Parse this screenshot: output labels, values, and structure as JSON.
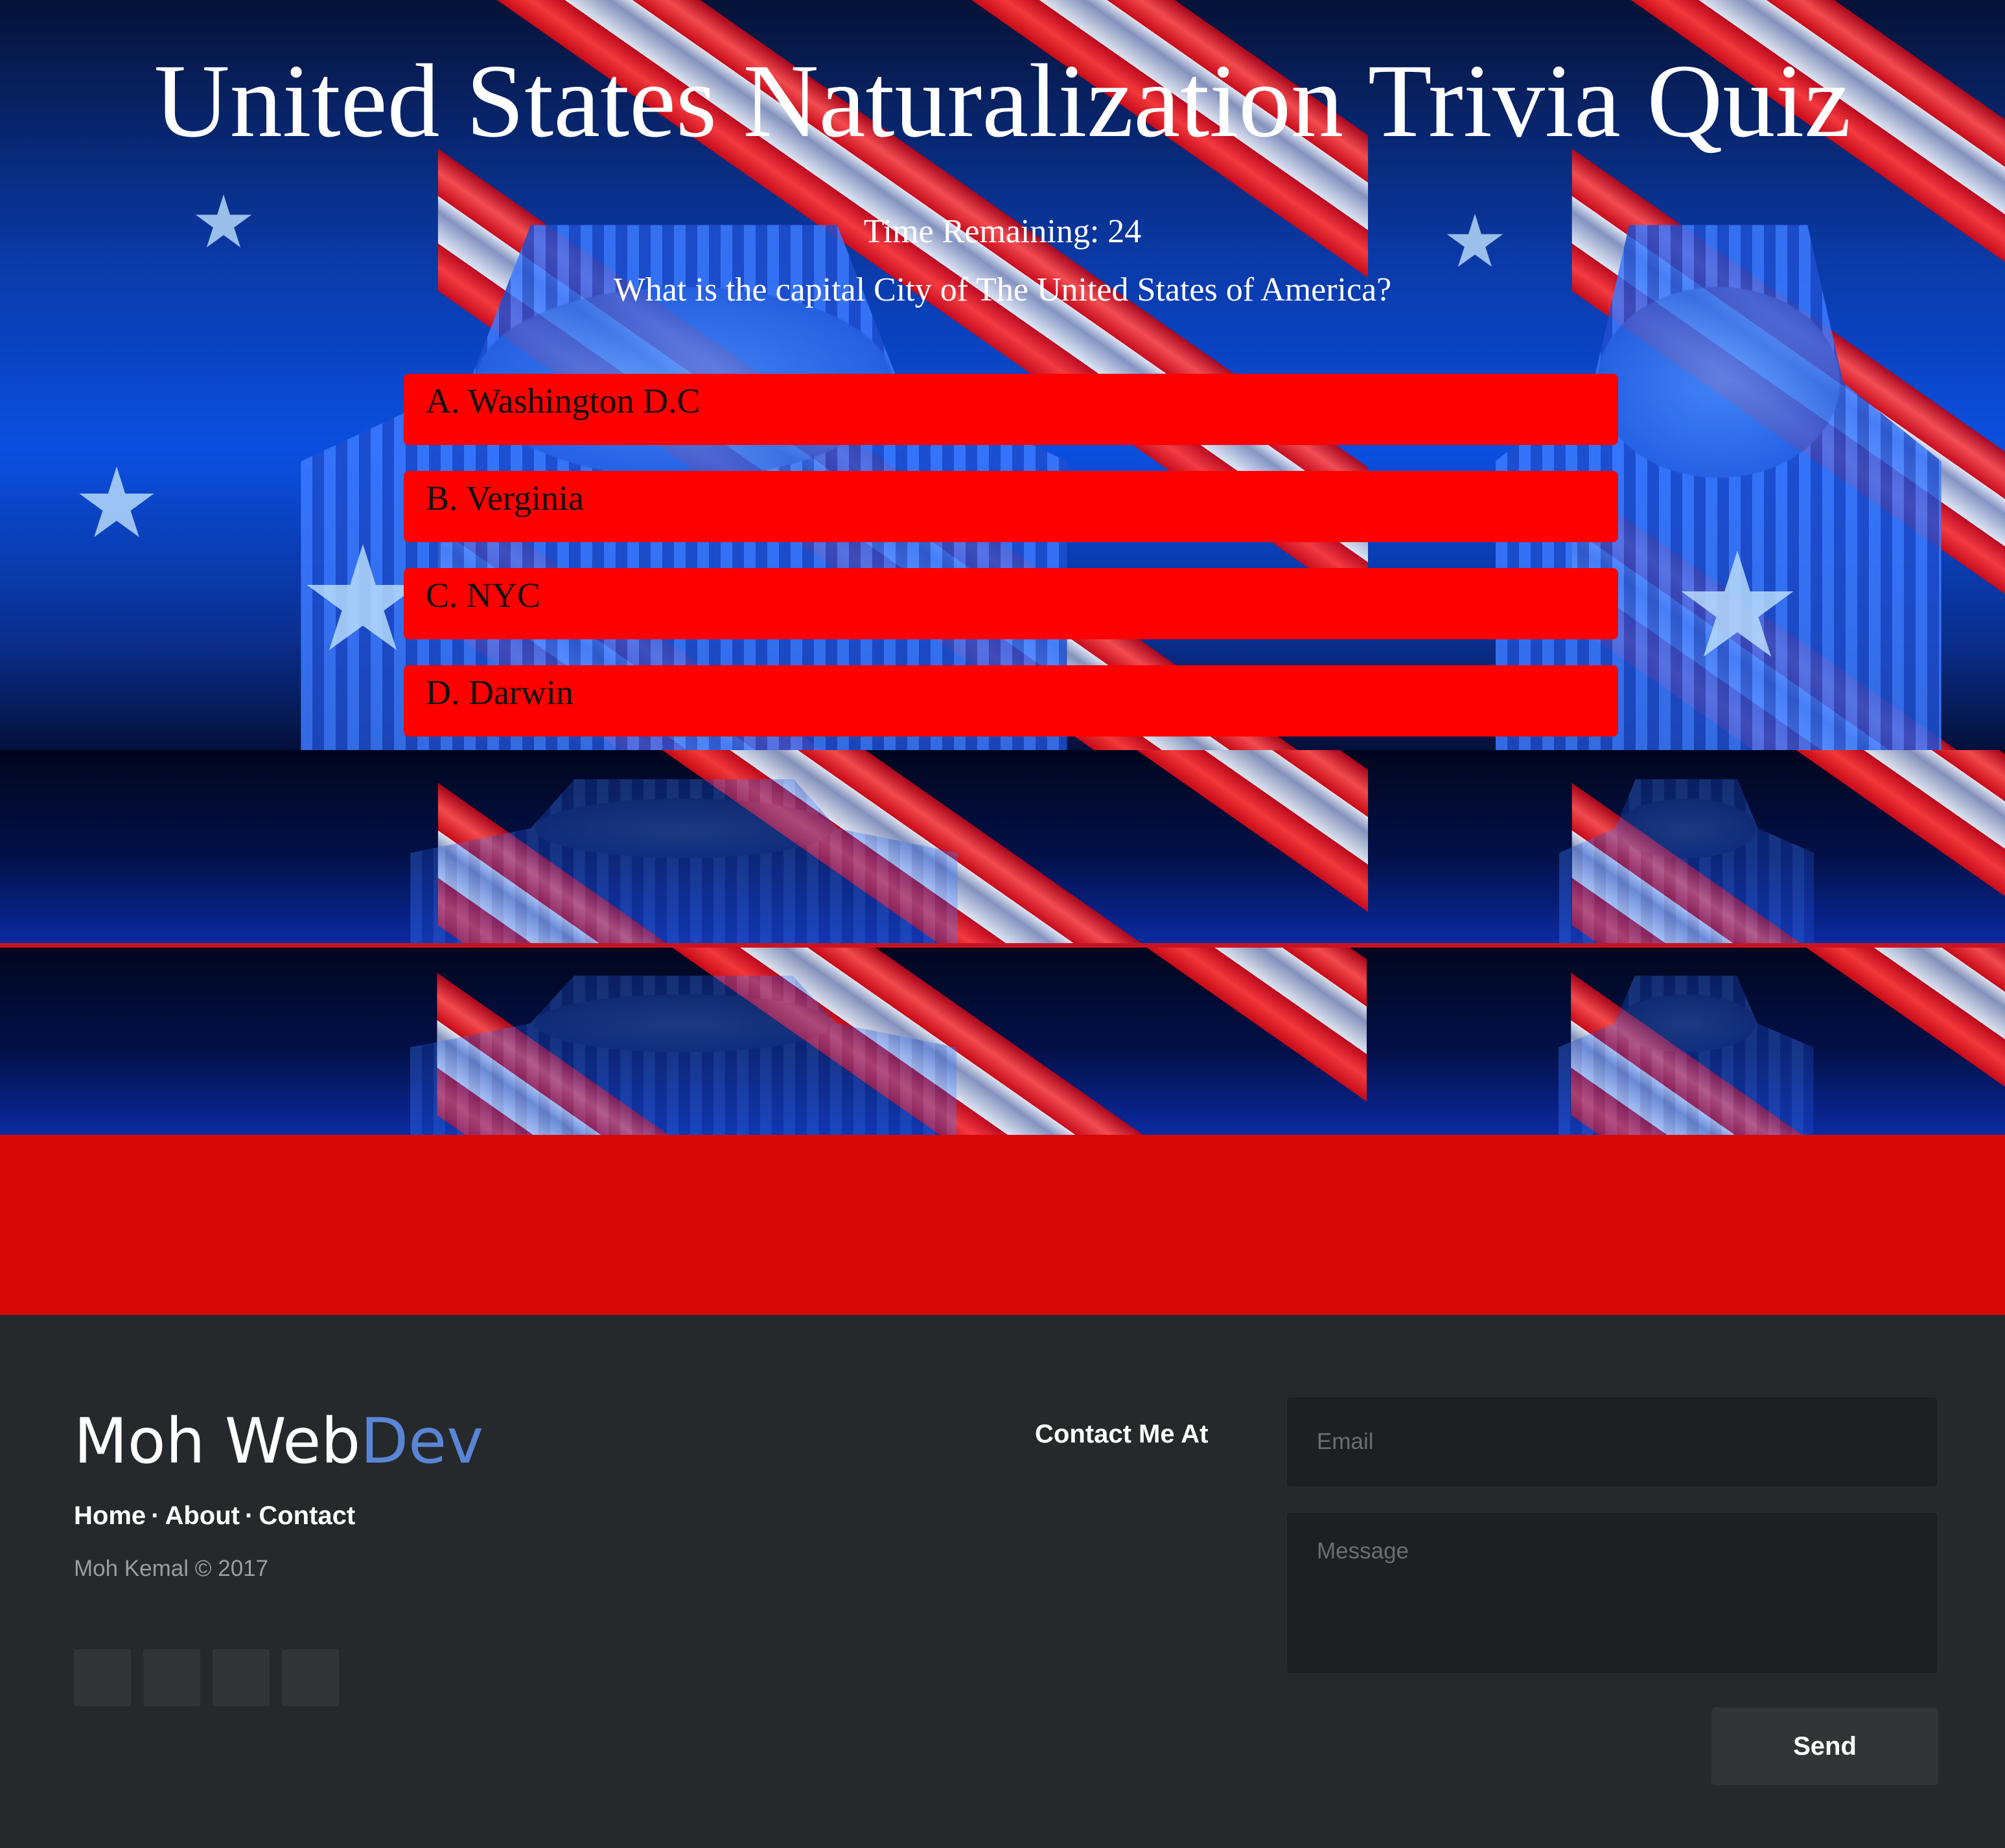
{
  "quiz": {
    "title": "United States Naturalization Trivia Quiz",
    "timer_text": "Time Remaining: 24",
    "question": "What is the capital City of The United States of America?",
    "answers": [
      "A. Washington D.C",
      "B. Verginia",
      "C. NYC",
      "D. Darwin"
    ]
  },
  "footer": {
    "brand_primary": "Moh Web",
    "brand_accent": "Dev",
    "nav": [
      "Home",
      "About",
      "Contact"
    ],
    "nav_separator": "·",
    "copyright": "Moh Kemal © 2017",
    "contact_label": "Contact Me At",
    "email_placeholder": "Email",
    "message_placeholder": "Message",
    "send_label": "Send"
  },
  "colors": {
    "answer_bg": "#ff0000",
    "red_band": "#d80707",
    "footer_bg": "#26292b",
    "brand_accent": "#5a85d6"
  }
}
